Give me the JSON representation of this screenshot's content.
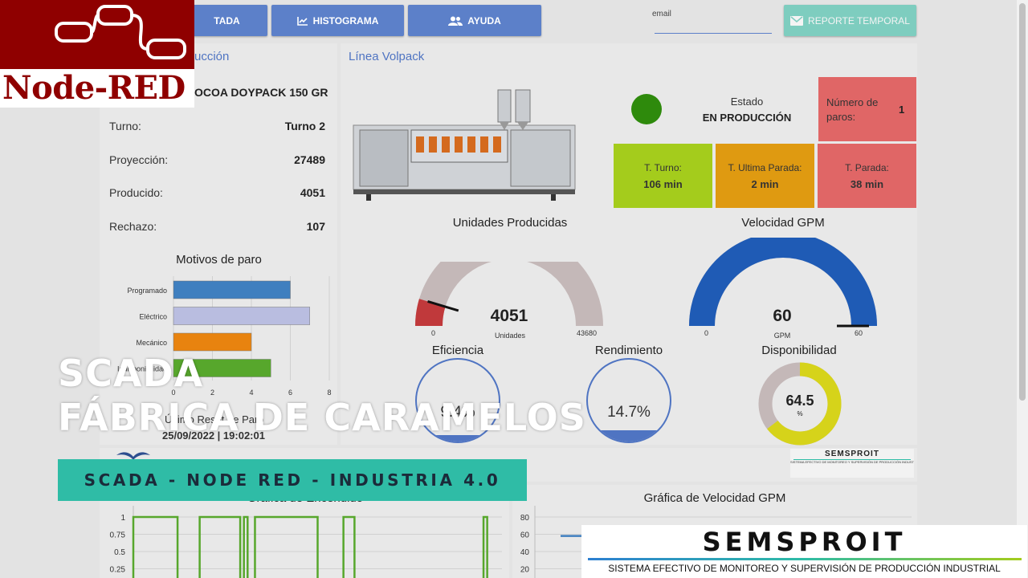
{
  "nav": {
    "buttons": [
      {
        "label": "TADA",
        "icon": "none"
      },
      {
        "label": "HISTOGRAMA",
        "icon": "chart-line-icon"
      },
      {
        "label": "AYUDA",
        "icon": "users-icon"
      }
    ],
    "email_label": "email",
    "report_button": "REPORTE TEMPORAL"
  },
  "logo": {
    "text": "Node-RED"
  },
  "production": {
    "section_title": "ucción",
    "product": "OCOA DOYPACK 150 GR",
    "rows": [
      {
        "label": "Turno:",
        "value": "Turno 2"
      },
      {
        "label": "Proyección:",
        "value": "27489"
      },
      {
        "label": "Producido:",
        "value": "4051"
      },
      {
        "label": "Rechazo:",
        "value": "107"
      }
    ]
  },
  "line": {
    "title": "Línea Volpack",
    "estado_label": "Estado",
    "estado_value": "EN PRODUCCIÓN",
    "status_color": "#2e8a0c",
    "paros_label": "Número de paros:",
    "paros_value": "1",
    "tiles": [
      {
        "label": "T. Turno:",
        "value": "106 min",
        "color": "#a4cc1c"
      },
      {
        "label": "T. Ultima Parada:",
        "value": "2 min",
        "color": "#df9a11"
      },
      {
        "label": "T. Parada:",
        "value": "38 min",
        "color": "#e06666"
      }
    ]
  },
  "gauges": {
    "units": {
      "title": "Unidades Producidas",
      "value": "4051",
      "unit": "Unidades",
      "min": "0",
      "max": "43680",
      "fraction": 0.093
    },
    "speed": {
      "title": "Velocidad GPM",
      "value": "60",
      "unit": "GPM",
      "min": "0",
      "max": "60",
      "fraction": 1.0
    }
  },
  "rings": {
    "eficiencia": {
      "title": "Eficiencia",
      "value": "9.4%"
    },
    "rendimiento": {
      "title": "Rendimiento",
      "value": "14.7%"
    },
    "disponibilidad": {
      "title": "Disponibilidad",
      "value": "64.5",
      "unit": "%",
      "fraction": 0.645
    }
  },
  "last_reset": {
    "label": "Último Reset de Paro",
    "value": "25/09/2022 | 19:02:01"
  },
  "charts": {
    "encendido_title": "Gráfica de Encendido",
    "velocidad_title": "Gráfica de Velocidad GPM"
  },
  "overlay": {
    "line1": "SCADA",
    "line2": "FÁBRICA DE CARAMELOS",
    "banner": "SCADA - NODE RED - INDUSTRIA 4.0"
  },
  "brand": {
    "name": "SEMSPROIT",
    "tagline": "SISTEMA EFECTIVO DE MONITOREO Y SUPERVISIÓN DE PRODUCCIÓN INDUSTRIAL"
  },
  "chart_data": [
    {
      "type": "bar",
      "title": "Motivos de paro",
      "orientation": "horizontal",
      "categories": [
        "Programado",
        "Eléctrico",
        "Mecánico",
        "Indisponibilidad"
      ],
      "values": [
        6,
        7,
        4,
        5
      ],
      "colors": [
        "#3f7fbf",
        "#b9bde0",
        "#e8830f",
        "#57a72c"
      ],
      "xlim": [
        0,
        8
      ],
      "xticks": [
        "0",
        "2",
        "4",
        "6",
        "8"
      ],
      "grid": true
    },
    {
      "type": "line",
      "title": "Gráfica de Encendido",
      "yticks": [
        "1",
        "0.75",
        "0.5",
        "0.25"
      ],
      "ylim": [
        0,
        1
      ],
      "color": "#57a72c",
      "pulses": [
        [
          0.0,
          0.12
        ],
        [
          0.18,
          0.29
        ],
        [
          0.3,
          0.31
        ],
        [
          0.33,
          0.5
        ],
        [
          0.57,
          0.6
        ],
        [
          0.95,
          0.96
        ]
      ]
    },
    {
      "type": "line",
      "title": "Gráfica de Velocidad GPM",
      "yticks": [
        "80",
        "60",
        "40",
        "20"
      ],
      "ylim": [
        0,
        80
      ],
      "color": "#3f7fbf",
      "values": [
        58,
        58,
        58
      ]
    }
  ]
}
